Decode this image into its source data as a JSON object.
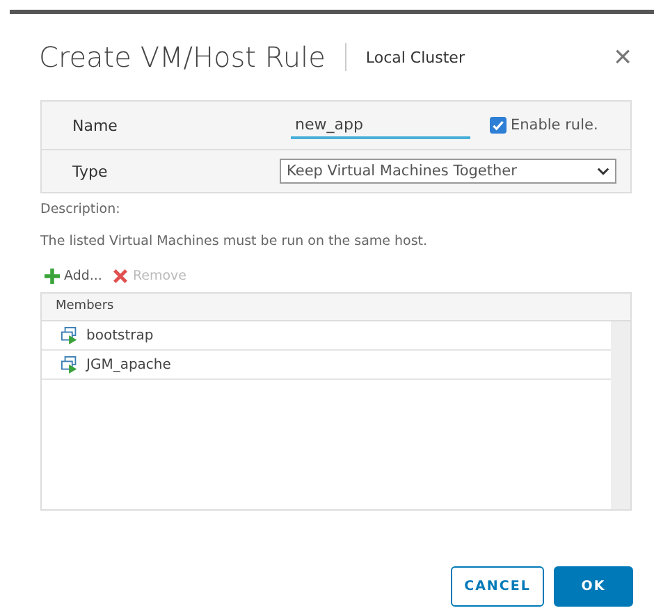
{
  "dialog": {
    "title": "Create VM/Host Rule",
    "subtitle": "Local Cluster",
    "close": "×"
  },
  "form": {
    "name_label": "Name",
    "name_value": "new_app",
    "enable_label": "Enable rule.",
    "enable_checked": true,
    "type_label": "Type",
    "type_value": "Keep Virtual Machines Together"
  },
  "description_label": "Description:",
  "description": "The listed Virtual Machines must be run on the same host.",
  "toolbar": [
    {
      "label": "Add...",
      "kind": "add",
      "disabled": false
    },
    {
      "label": "Remove",
      "kind": "remove",
      "disabled": true
    }
  ],
  "members": {
    "column": "Members",
    "rows": [
      {
        "name": "bootstrap"
      },
      {
        "name": "JGM_apache"
      }
    ]
  },
  "buttons": [
    {
      "label": "CANCEL",
      "kind": "secondary"
    },
    {
      "label": "OK",
      "kind": "primary"
    }
  ]
}
